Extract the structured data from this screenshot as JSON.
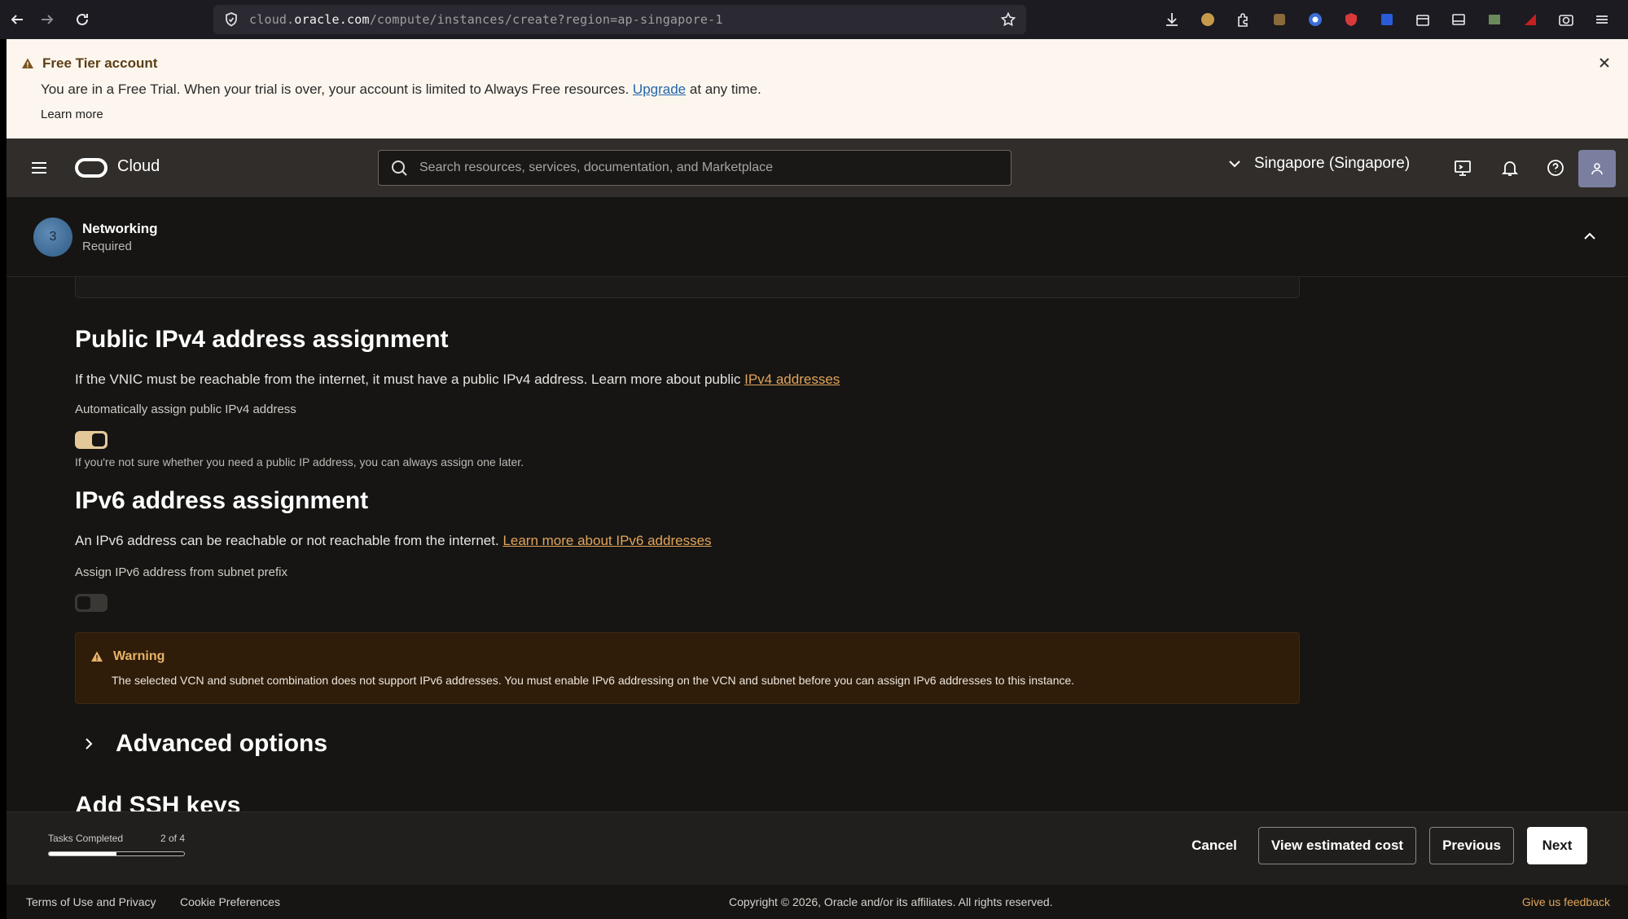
{
  "browser": {
    "url_prefix": "cloud.",
    "url_domain": "oracle.com",
    "url_path": "/compute/instances/create?region=ap-singapore-1"
  },
  "banner": {
    "title": "Free Tier account",
    "text_before": "You are in a Free Trial. When your trial is over, your account is limited to Always Free resources.",
    "upgrade_link": "Upgrade",
    "text_after": "at any time.",
    "learn_more": "Learn more"
  },
  "header": {
    "logo_text": "Cloud",
    "search_placeholder": "Search resources, services, documentation, and Marketplace",
    "region": "Singapore (Singapore)"
  },
  "step": {
    "number": "3",
    "title": "Networking",
    "subtitle": "Required"
  },
  "ipv4": {
    "heading": "Public IPv4 address assignment",
    "description": "If the VNIC must be reachable from the internet, it must have a public IPv4 address. Learn more about public",
    "link": "IPv4 addresses",
    "toggle_label": "Automatically assign public IPv4 address",
    "toggle_on": true,
    "hint": "If you're not sure whether you need a public IP address, you can always assign one later."
  },
  "ipv6": {
    "heading": "IPv6 address assignment",
    "description": "An IPv6 address can be reachable or not reachable from the internet.",
    "link": "Learn more about IPv6 addresses",
    "toggle_label": "Assign IPv6 address from subnet prefix",
    "toggle_on": false
  },
  "warning": {
    "title": "Warning",
    "text": "The selected VCN and subnet combination does not support IPv6 addresses. You must enable IPv6 addressing on the VCN and subnet before you can assign IPv6 addresses to this instance."
  },
  "advanced": {
    "label": "Advanced options"
  },
  "ssh": {
    "heading": "Add SSH keys"
  },
  "progress": {
    "label": "Tasks Completed",
    "count": "2 of 4",
    "fraction": 0.5
  },
  "actions": {
    "cancel": "Cancel",
    "estimate": "View estimated cost",
    "previous": "Previous",
    "next": "Next"
  },
  "footer": {
    "terms": "Terms of Use and Privacy",
    "cookies": "Cookie Preferences",
    "copyright": "Copyright © 2026, Oracle and/or its affiliates. All rights reserved.",
    "feedback": "Give us feedback"
  }
}
